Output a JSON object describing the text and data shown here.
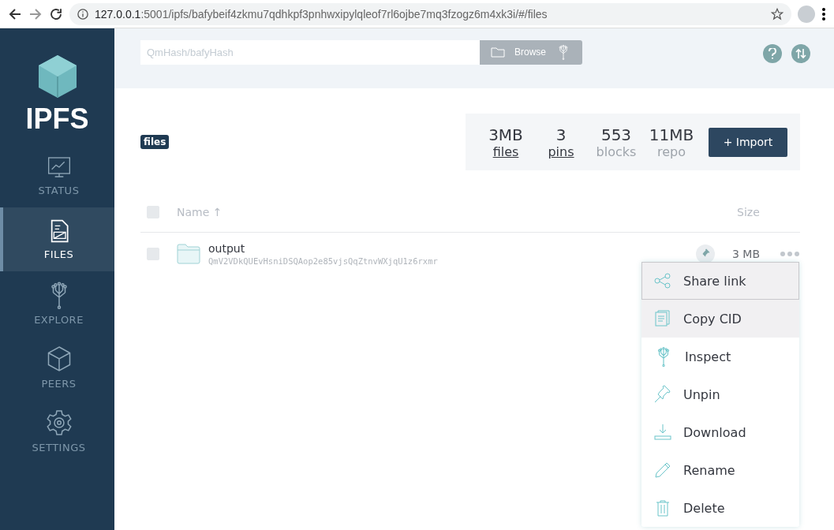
{
  "browser": {
    "url_host": "127.0.0.1",
    "url_rest": ":5001/ipfs/bafybeif4zkmu7qdhkpf3pnhwxipylqleof7rl6ojbe7mq3fzogz6m4xk3i/#/files"
  },
  "sidebar": {
    "logo": "IPFS",
    "items": [
      {
        "label": "STATUS",
        "kind": "status",
        "selected": false
      },
      {
        "label": "FILES",
        "kind": "files",
        "selected": true
      },
      {
        "label": "EXPLORE",
        "kind": "explore",
        "selected": false
      },
      {
        "label": "PEERS",
        "kind": "peers",
        "selected": false
      },
      {
        "label": "SETTINGS",
        "kind": "settings",
        "selected": false
      }
    ]
  },
  "search": {
    "placeholder": "QmHash/bafyHash",
    "button": "Browse"
  },
  "breadcrumb": "files",
  "stats": [
    {
      "value": "3MB",
      "label": "files",
      "kind": "link"
    },
    {
      "value": "3",
      "label": "pins",
      "kind": "link"
    },
    {
      "value": "553",
      "label": "blocks",
      "kind": "plain"
    },
    {
      "value": "11MB",
      "label": "repo",
      "kind": "plain"
    }
  ],
  "import_button": "+ Import",
  "table": {
    "columns": [
      "Name ↑",
      "Size"
    ],
    "all_checked": false,
    "rows": [
      {
        "name": "output",
        "cid": "QmV2VDkQUEvHsniDSQAop2e85vjsQqZtnvWXjqU1z6rxmr",
        "size": "3 MB",
        "checked": false,
        "pinned": true
      }
    ]
  },
  "context_menu": {
    "items": [
      {
        "label": "Share link",
        "kind": "share",
        "focused": true,
        "hovered": false
      },
      {
        "label": "Copy CID",
        "kind": "copy",
        "focused": false,
        "hovered": true
      },
      {
        "label": "Inspect",
        "kind": "inspect",
        "focused": false,
        "hovered": false
      },
      {
        "label": "Unpin",
        "kind": "pin",
        "focused": false,
        "hovered": false
      },
      {
        "label": "Download",
        "kind": "download",
        "focused": false,
        "hovered": false
      },
      {
        "label": "Rename",
        "kind": "rename",
        "focused": false,
        "hovered": false
      },
      {
        "label": "Delete",
        "kind": "delete",
        "focused": false,
        "hovered": false
      }
    ]
  }
}
